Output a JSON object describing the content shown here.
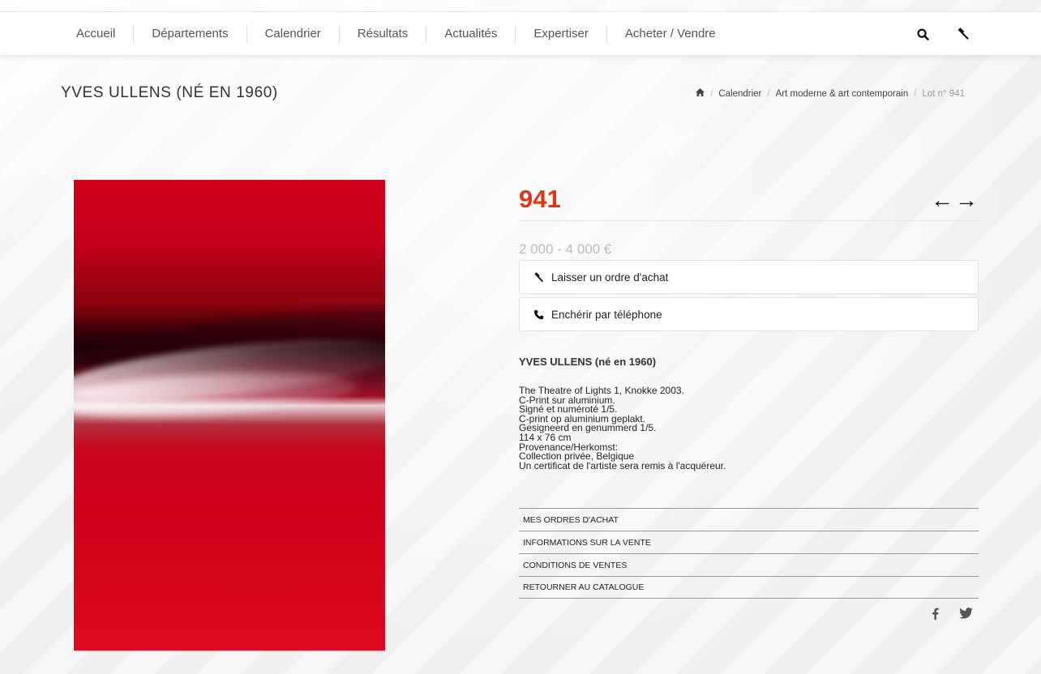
{
  "nav": {
    "items": [
      "Accueil",
      "Départements",
      "Calendrier",
      "Résultats",
      "Actualités",
      "Expertiser",
      "Acheter / Vendre"
    ],
    "icons": [
      "search-icon",
      "gavel-icon"
    ]
  },
  "header": {
    "title": "YVES ULLENS (NÉ EN 1960)",
    "breadcrumb": {
      "home_icon": "home-icon",
      "items": [
        "Calendrier",
        "Art moderne & art contemporain"
      ],
      "current": "Lot n° 941",
      "separator": "/"
    }
  },
  "lot": {
    "number": "941",
    "prev_arrow": "←",
    "next_arrow": "→",
    "estimate": "2 000 - 4 000 €",
    "actions": [
      {
        "label": "Laisser un ordre d'achat",
        "icon": "gavel-icon"
      },
      {
        "label": "Enchérir par téléphone",
        "icon": "phone-icon"
      }
    ],
    "heading": "YVES ULLENS (né en 1960)",
    "description": [
      "The Theatre of Lights 1, Knokke 2003.",
      "C-Print sur aluminium.",
      "Signé et numéroté 1/5.",
      "C-print op aluminium geplakt.",
      "Gesigneerd en genummerd 1/5.",
      "114 x 76 cm",
      "Provenance/Herkomst:",
      "Collection privée, Belgique",
      "Un certificat de l'artiste sera remis à l'acquéreur."
    ],
    "links": [
      "MES ORDRES D'ACHAT",
      "INFORMATIONS SUR LA VENTE",
      "CONDITIONS DE VENTES",
      "RETOURNER AU CATALOGUE"
    ],
    "social": [
      {
        "name": "facebook-icon",
        "glyph": "f"
      },
      {
        "name": "twitter-icon",
        "glyph": "t"
      }
    ]
  },
  "colors": {
    "accent": "#e63312",
    "estimate": "#bbbbbb"
  }
}
